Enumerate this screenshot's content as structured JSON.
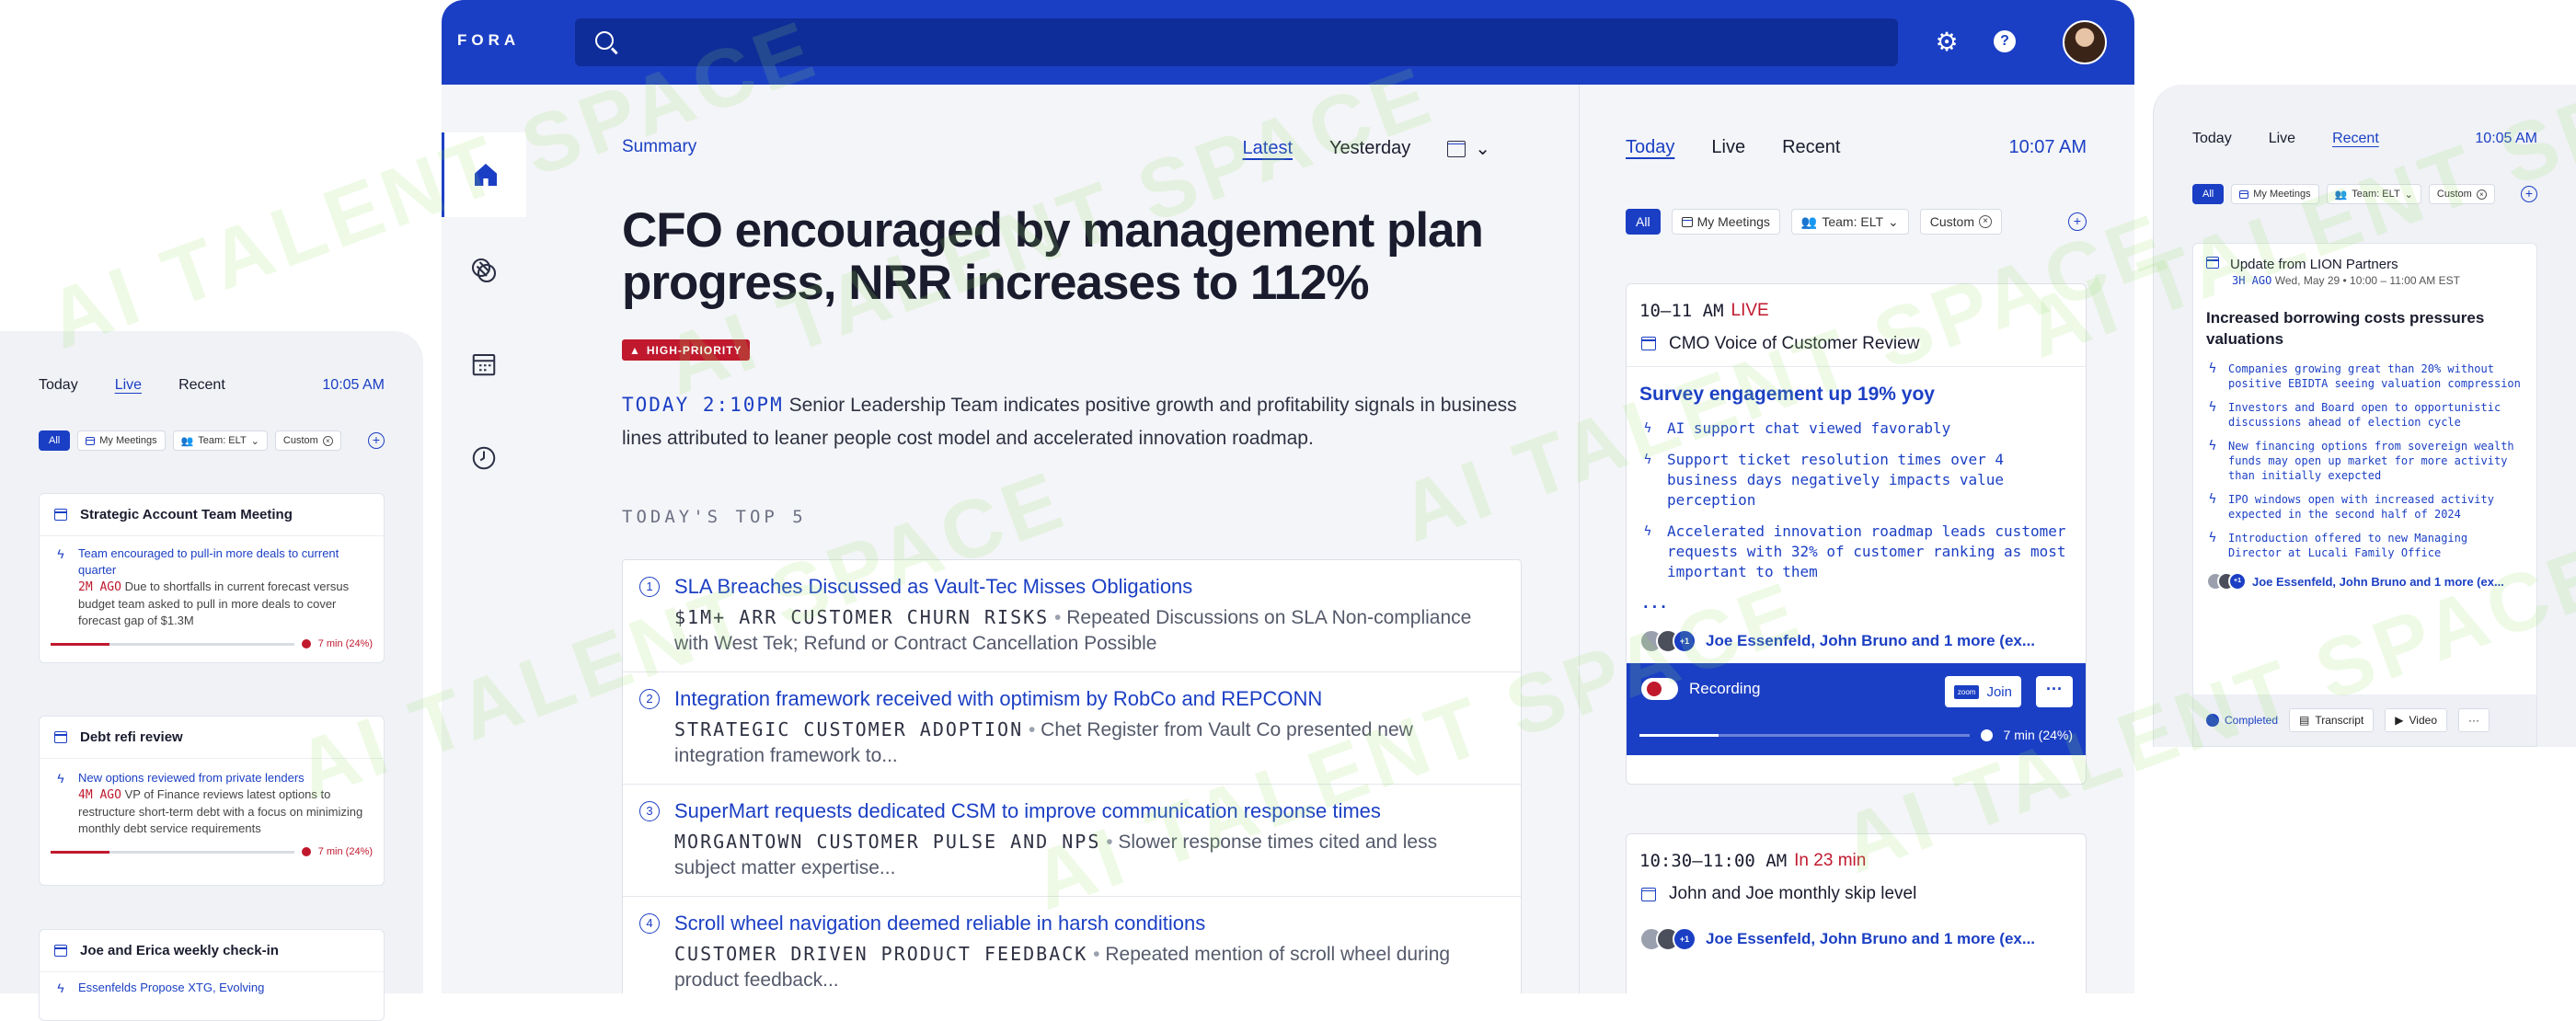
{
  "app": {
    "logo": "FORA",
    "watermark": "AI TALENT SPACE"
  },
  "colors": {
    "accent": "#1b3fc4",
    "alert": "#c0192e",
    "background": "#f4f5f8"
  },
  "main": {
    "summary": "Summary",
    "tabs": [
      "Latest",
      "Yesterday"
    ],
    "headline": "CFO encouraged by management plan progress, NRR increases to 112%",
    "priority": "HIGH-PRIORITY",
    "lead_stamp": "TODAY 2:10PM",
    "lead_text": "Senior Leadership Team indicates positive growth and profitability signals in business lines attributed to leaner people cost model and accelerated innovation roadmap.",
    "top5_label": "TODAY'S TOP 5",
    "top5": [
      {
        "num": "1",
        "title": "SLA Breaches Discussed as Vault-Tec Misses Obligations",
        "tag": "$1M+ ARR CUSTOMER CHURN RISKS",
        "desc": "Repeated Discussions on SLA Non-compliance with West Tek; Refund or Contract Cancellation Possible"
      },
      {
        "num": "2",
        "title": "Integration framework received with optimism by RobCo and REPCONN",
        "tag": "STRATEGIC CUSTOMER ADOPTION",
        "desc": "Chet Register from Vault Co presented new integration framework to..."
      },
      {
        "num": "3",
        "title": "SuperMart requests dedicated CSM to improve communication response times",
        "tag": "MORGANTOWN CUSTOMER PULSE AND NPS",
        "desc": "Slower response times cited and less subject matter expertise..."
      },
      {
        "num": "4",
        "title": "Scroll wheel navigation deemed reliable in harsh conditions",
        "tag": "CUSTOMER DRIVEN PRODUCT FEEDBACK",
        "desc": "Repeated mention of scroll wheel during product feedback..."
      }
    ]
  },
  "right": {
    "tabs": [
      "Today",
      "Live",
      "Recent"
    ],
    "time": "10:07 AM",
    "chips": {
      "all": "All",
      "meetings": "My Meetings",
      "team": "Team: ELT",
      "custom": "Custom"
    },
    "event1": {
      "time": "10–11 AM",
      "status": "LIVE",
      "title": "CMO Voice of Customer Review",
      "headline": "Survey engagement up 19% yoy",
      "bullets": [
        "AI support chat viewed favorably",
        "Support ticket resolution times over 4 business days negatively impacts value perception",
        "Accelerated innovation roadmap leads customer requests with 32% of customer ranking as most important to them"
      ],
      "ellipsis": "...",
      "people": "Joe Essenfeld, John Bruno and 1 more (ex...",
      "plus": "+1",
      "recording": "Recording",
      "join": "Join",
      "zoom": "zoom",
      "progress_label": "7 min (24%)",
      "progress": 0.24
    },
    "event2": {
      "time": "10:30–11:00 AM",
      "status": "In 23 min",
      "title": "John and Joe monthly skip level",
      "people": "Joe Essenfeld, John Bruno and 1 more (ex..."
    }
  },
  "left_panel": {
    "tabs": [
      "Today",
      "Live",
      "Recent"
    ],
    "time": "10:05 AM",
    "cards": [
      {
        "title": "Strategic Account Team Meeting",
        "bullet": "Team encouraged to pull-in more deals to current quarter",
        "ago": "2M AGO",
        "desc": "Due to shortfalls in current forecast versus budget team asked to pull in more deals to cover forecast gap of $1.3M",
        "progress": "7 min (24%)"
      },
      {
        "title": "Debt refi review",
        "bullet": "New options reviewed from private lenders",
        "ago": "4M AGO",
        "desc": "VP of Finance reviews latest options to restructure short-term debt with a  focus on minimizing monthly debt service requirements",
        "progress": "7 min (24%)"
      },
      {
        "title": "Joe and Erica weekly check-in",
        "bullet": "Essenfelds Propose XTG, Evolving"
      }
    ]
  },
  "right_panel": {
    "tabs": [
      "Today",
      "Live",
      "Recent"
    ],
    "time": "10:05 AM",
    "card": {
      "title": "Update from LION Partners",
      "ago": "3H AGO",
      "when": "Wed, May 29 • 10:00 – 11:00 AM EST",
      "headline": "Increased borrowing costs pressures valuations",
      "bullets": [
        "Companies growing great than 20% without positive EBIDTA seeing valuation compression",
        "Investors and Board open to opportunistic discussions ahead of election cycle",
        "New financing options from sovereign wealth funds may open up market for more activity than initially exepcted",
        "IPO windows open with increased activity expected in the second half of 2024",
        "Introduction offered to new Managing Director at Lucali Family Office"
      ],
      "people": "Joe Essenfeld, John Bruno and 1 more (ex...",
      "completed": "Completed",
      "transcript": "Transcript",
      "video": "Video"
    }
  }
}
